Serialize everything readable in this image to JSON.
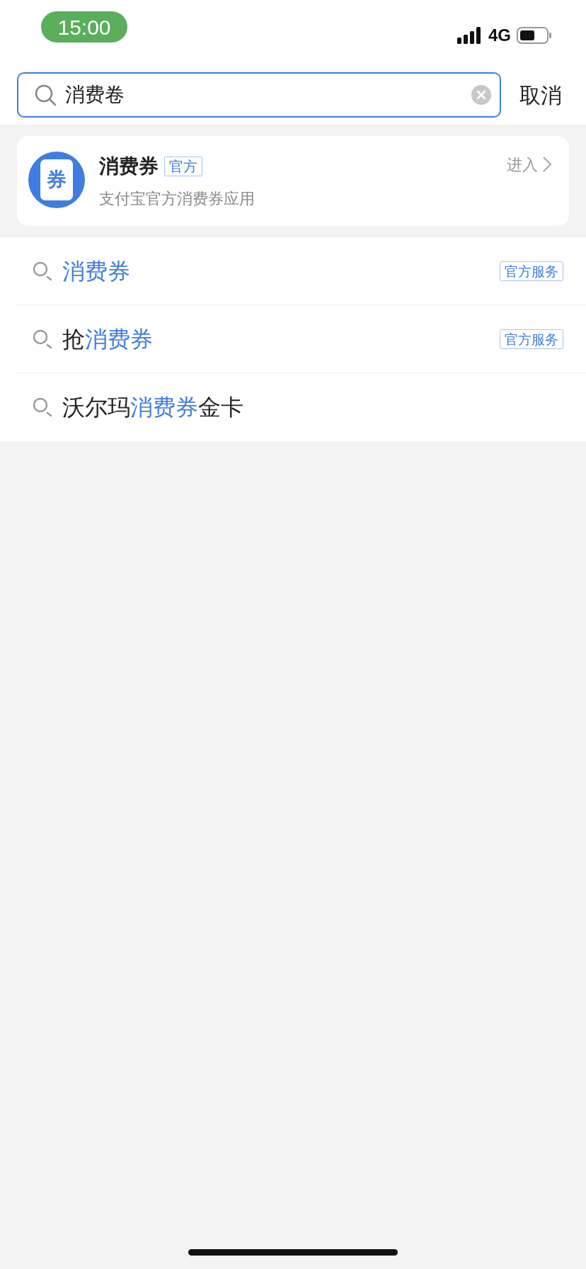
{
  "status_bar": {
    "time": "15:00",
    "network": "4G"
  },
  "search": {
    "value": "消费卷",
    "cancel": "取消"
  },
  "app_card": {
    "icon_glyph": "券",
    "title": "消费券",
    "badge": "官方",
    "subtitle": "支付宝官方消费券应用",
    "action": "进入"
  },
  "suggestions": [
    {
      "parts": [
        {
          "text": "消费券",
          "highlight": true
        }
      ],
      "tag": "官方服务"
    },
    {
      "parts": [
        {
          "text": "抢",
          "highlight": false
        },
        {
          "text": "消费券",
          "highlight": true
        }
      ],
      "tag": "官方服务"
    },
    {
      "parts": [
        {
          "text": "沃尔玛",
          "highlight": false
        },
        {
          "text": "消费券",
          "highlight": true
        },
        {
          "text": "金卡",
          "highlight": false
        }
      ]
    }
  ]
}
